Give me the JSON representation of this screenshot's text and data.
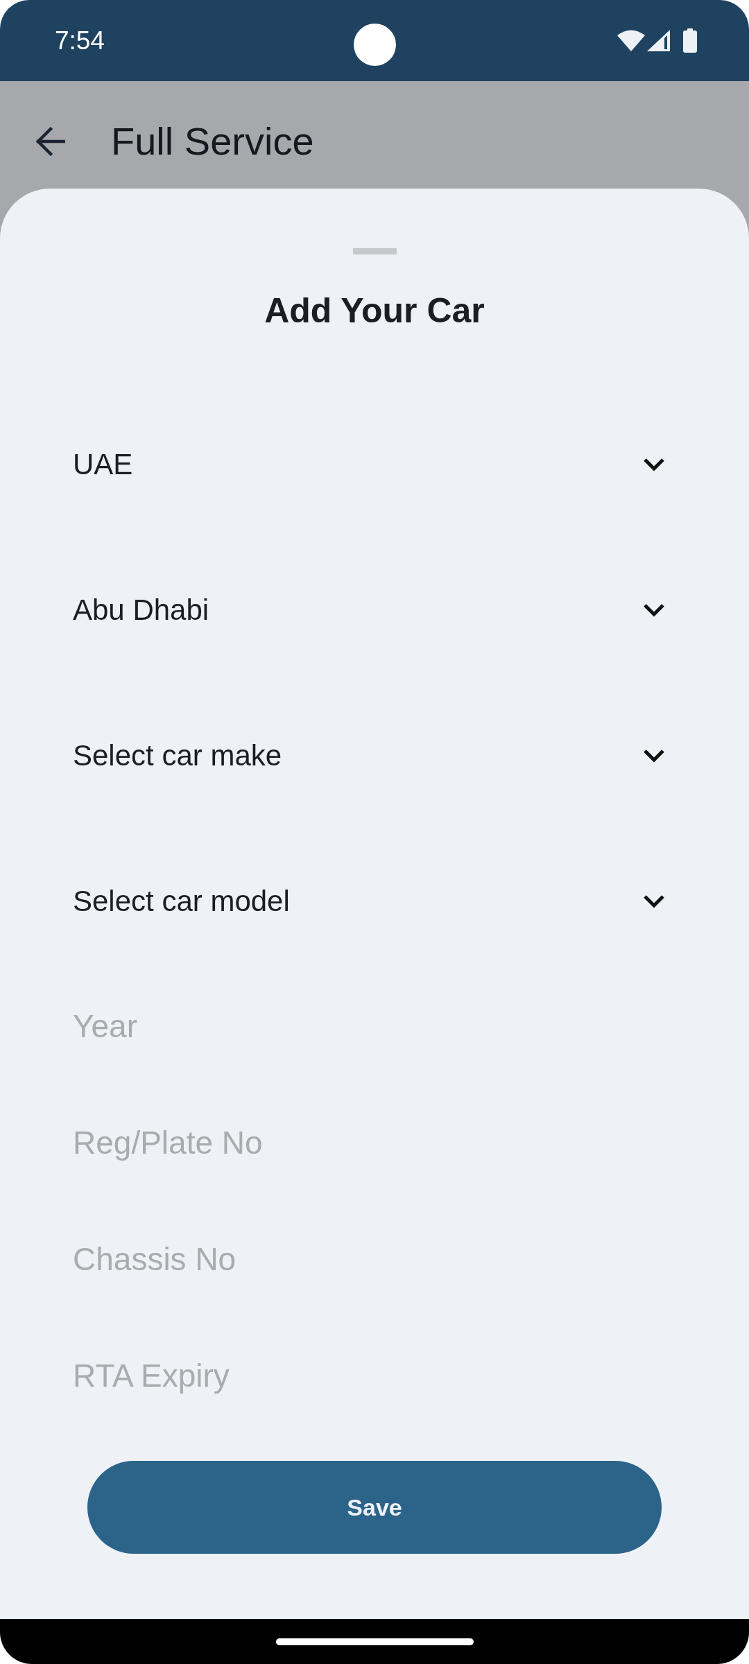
{
  "status_bar": {
    "time": "7:54"
  },
  "app_bar": {
    "title": "Full Service"
  },
  "sheet": {
    "title": "Add Your Car",
    "fields": [
      {
        "kind": "dropdown",
        "value": "UAE"
      },
      {
        "kind": "dropdown",
        "value": "Abu Dhabi"
      },
      {
        "kind": "dropdown",
        "placeholder": "Select car make"
      },
      {
        "kind": "dropdown",
        "placeholder": "Select car model"
      },
      {
        "kind": "text",
        "placeholder": "Year"
      },
      {
        "kind": "text",
        "placeholder": "Reg/Plate No"
      },
      {
        "kind": "text",
        "placeholder": "Chassis No"
      },
      {
        "kind": "text",
        "placeholder": "RTA Expiry"
      }
    ],
    "save_button": "Save"
  }
}
